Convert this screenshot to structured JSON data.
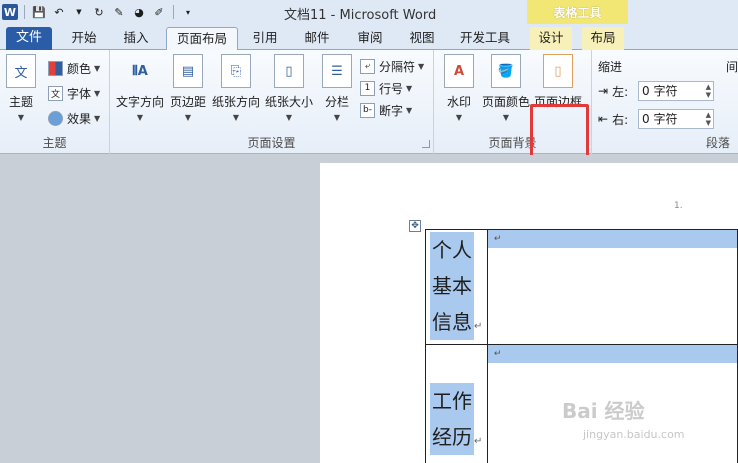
{
  "window": {
    "title": "文档11 - Microsoft Word",
    "context_group": "表格工具"
  },
  "qat": {
    "app_icon": "W",
    "save_icon": "save-icon",
    "undo_icon": "undo-icon",
    "redo_icon": "redo-icon"
  },
  "tabs": [
    "文件",
    "开始",
    "插入",
    "页面布局",
    "引用",
    "邮件",
    "审阅",
    "视图",
    "开发工具",
    "设计",
    "布局"
  ],
  "active_tab": "页面布局",
  "ribbon": {
    "theme_group": {
      "label": "主题",
      "theme_button": "主题",
      "colors": "颜色",
      "fonts": "字体",
      "effects": "效果"
    },
    "page_setup_group": {
      "label": "页面设置",
      "text_direction": "文字方向",
      "margins": "页边距",
      "orientation": "纸张方向",
      "size": "纸张大小",
      "columns": "分栏",
      "breaks": "分隔符",
      "line_numbers": "行号",
      "hyphenation": "断字"
    },
    "page_background_group": {
      "label": "页面背景",
      "watermark": "水印",
      "page_color": "页面颜色",
      "page_borders": "页面边框"
    },
    "paragraph_group": {
      "label": "段落",
      "indent_title": "缩进",
      "left_label": "左:",
      "left_value": "0 字符",
      "right_label": "右:",
      "right_value": "0 字符",
      "spacing_title": "间"
    }
  },
  "document": {
    "ruler_mark": "1.",
    "rows": [
      {
        "label_lines": [
          "个人",
          "基本",
          "信息"
        ],
        "end_mark": "↵",
        "cell_mark": "↵"
      },
      {
        "label_lines": [
          "工作",
          "经历"
        ],
        "end_mark": "↵",
        "cell_mark": "↵"
      }
    ]
  },
  "watermark": {
    "line1": "Bai 经验",
    "line2": "jingyan.baidu.com"
  }
}
